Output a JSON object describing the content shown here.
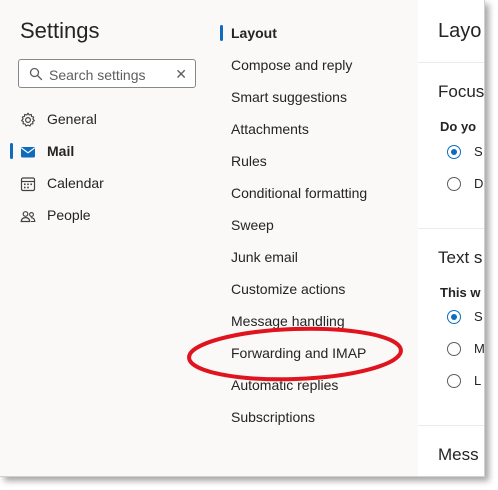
{
  "sidebar": {
    "title": "Settings",
    "search": {
      "placeholder": "Search settings",
      "value": ""
    },
    "categories": [
      {
        "label": "General",
        "icon": "gear-icon",
        "active": false
      },
      {
        "label": "Mail",
        "icon": "mail-icon",
        "active": true
      },
      {
        "label": "Calendar",
        "icon": "calendar-icon",
        "active": false
      },
      {
        "label": "People",
        "icon": "people-icon",
        "active": false
      }
    ]
  },
  "mail_nav": {
    "items": [
      {
        "label": "Layout",
        "active": true
      },
      {
        "label": "Compose and reply",
        "active": false
      },
      {
        "label": "Smart suggestions",
        "active": false
      },
      {
        "label": "Attachments",
        "active": false
      },
      {
        "label": "Rules",
        "active": false
      },
      {
        "label": "Conditional formatting",
        "active": false
      },
      {
        "label": "Sweep",
        "active": false
      },
      {
        "label": "Junk email",
        "active": false
      },
      {
        "label": "Customize actions",
        "active": false
      },
      {
        "label": "Message handling",
        "active": false
      },
      {
        "label": "Forwarding and IMAP",
        "active": false,
        "highlighted": true
      },
      {
        "label": "Automatic replies",
        "active": false
      },
      {
        "label": "Subscriptions",
        "active": false
      }
    ]
  },
  "content": {
    "title": "Layo",
    "focused_inbox": {
      "heading": "Focus",
      "question": "Do yo",
      "options": [
        {
          "label": "S",
          "checked": true
        },
        {
          "label": "D",
          "checked": false
        }
      ]
    },
    "text_size": {
      "heading": "Text s",
      "question": "This w",
      "options": [
        {
          "label": "S",
          "checked": true
        },
        {
          "label": "M",
          "checked": false
        },
        {
          "label": "L",
          "checked": false
        }
      ]
    },
    "message_heading": "Mess"
  },
  "colors": {
    "accent": "#0f6cbd",
    "annotation": "#e0141e",
    "background": "#faf9f8",
    "panel": "#ffffff"
  }
}
